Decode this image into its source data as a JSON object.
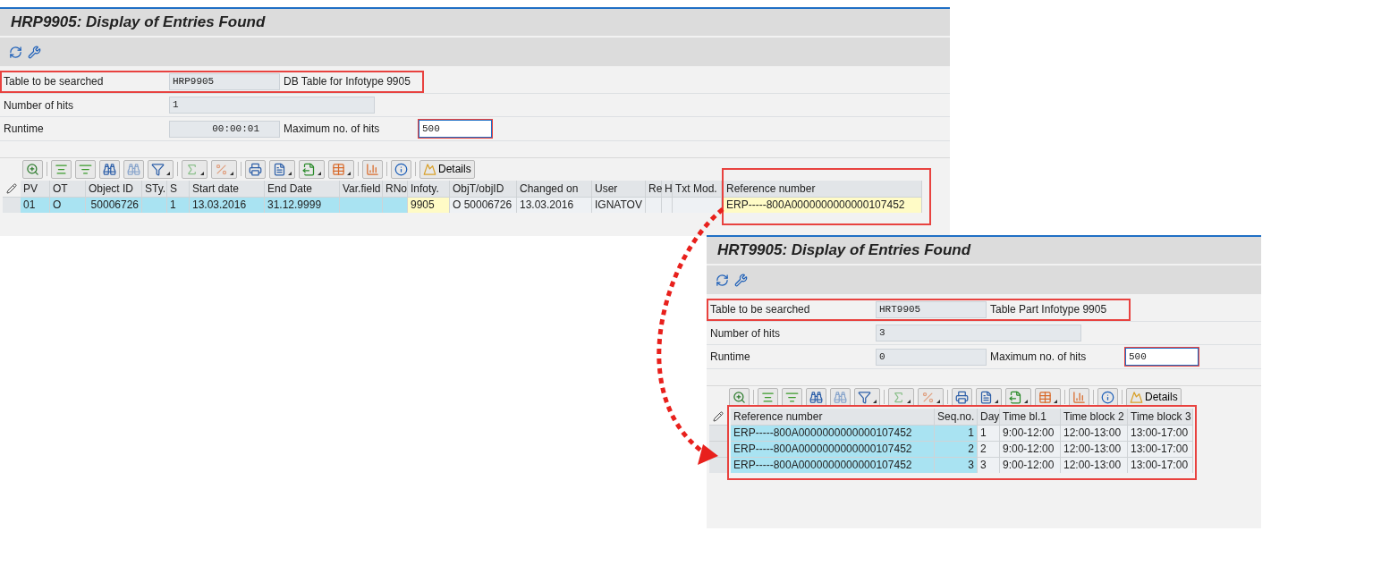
{
  "screens": [
    {
      "title": "HRP9905: Display of Entries Found",
      "fields": [
        {
          "label": "Table to be searched",
          "value": "HRP9905",
          "kind": "short",
          "side_label": "DB Table for Infotype 9905",
          "highlighted": true
        },
        {
          "label": "Number of hits",
          "value": "1",
          "kind": "long",
          "highlighted": false
        },
        {
          "label": "Runtime",
          "value": "00:00:01",
          "kind": "short",
          "side_label": "Maximum no. of hits",
          "side_input": "500",
          "highlighted": false
        }
      ],
      "details_button": "Details",
      "table": {
        "highlighted": false,
        "columns": [
          {
            "label": "PV",
            "kind": "key",
            "highlighted": false,
            "cells": [
              "01"
            ]
          },
          {
            "label": "OT",
            "kind": "key",
            "highlighted": false,
            "cells": [
              "O"
            ]
          },
          {
            "label": "Object ID",
            "kind": "key_num",
            "highlighted": false,
            "cells": [
              "50006726"
            ]
          },
          {
            "label": "STy.",
            "kind": "key",
            "highlighted": false,
            "cells": [
              ""
            ]
          },
          {
            "label": "S",
            "kind": "key",
            "highlighted": false,
            "cells": [
              "1"
            ]
          },
          {
            "label": "Start date",
            "kind": "key",
            "highlighted": false,
            "cells": [
              "13.03.2016"
            ]
          },
          {
            "label": "End Date",
            "kind": "key",
            "highlighted": false,
            "cells": [
              "31.12.9999"
            ]
          },
          {
            "label": "Var.field",
            "kind": "key",
            "highlighted": false,
            "cells": [
              ""
            ]
          },
          {
            "label": "RNo",
            "kind": "key",
            "highlighted": false,
            "cells": [
              ""
            ]
          },
          {
            "label": "Infoty.",
            "kind": "note",
            "highlighted": false,
            "cells": [
              "9905"
            ]
          },
          {
            "label": "ObjT/objID",
            "kind": "text",
            "highlighted": false,
            "cells": [
              "O 50006726"
            ]
          },
          {
            "label": "Changed on",
            "kind": "text",
            "highlighted": false,
            "cells": [
              "13.03.2016"
            ]
          },
          {
            "label": "User",
            "kind": "text",
            "highlighted": false,
            "cells": [
              "IGNATOV"
            ]
          },
          {
            "label": "Re",
            "kind": "text",
            "highlighted": false,
            "cells": [
              ""
            ]
          },
          {
            "label": "H",
            "kind": "text",
            "highlighted": false,
            "cells": [
              ""
            ]
          },
          {
            "label": "Txt Mod.",
            "kind": "text",
            "highlighted": false,
            "cells": [
              ""
            ]
          },
          {
            "label": "Reference number",
            "kind": "note",
            "highlighted": true,
            "cells": [
              "ERP-----800A0000000000000107452"
            ]
          }
        ]
      }
    },
    {
      "title": "HRT9905: Display of Entries Found",
      "fields": [
        {
          "label": "Table to be searched",
          "value": "HRT9905",
          "kind": "short",
          "side_label": "Table Part Infotype 9905",
          "highlighted": true
        },
        {
          "label": "Number of hits",
          "value": "3",
          "kind": "long",
          "highlighted": false
        },
        {
          "label": "Runtime",
          "value": "0",
          "kind": "short",
          "side_label": "Maximum no. of hits",
          "side_input": "500",
          "highlighted": false
        }
      ],
      "details_button": "Details",
      "table": {
        "highlighted": true,
        "columns": [
          {
            "label": "Reference number",
            "kind": "key",
            "highlighted": false,
            "cells": [
              "ERP-----800A0000000000000107452",
              "ERP-----800A0000000000000107452",
              "ERP-----800A0000000000000107452"
            ]
          },
          {
            "label": "Seq.no.",
            "kind": "key_num",
            "highlighted": false,
            "cells": [
              "1",
              "2",
              "3"
            ]
          },
          {
            "label": "Day",
            "kind": "text",
            "highlighted": false,
            "cells": [
              "1",
              "2",
              "3"
            ]
          },
          {
            "label": "Time bl.1",
            "kind": "text",
            "highlighted": false,
            "cells": [
              "9:00-12:00",
              "9:00-12:00",
              "9:00-12:00"
            ]
          },
          {
            "label": "Time block 2",
            "kind": "text",
            "highlighted": false,
            "cells": [
              "12:00-13:00",
              "12:00-13:00",
              "12:00-13:00"
            ]
          },
          {
            "label": "Time block 3",
            "kind": "text",
            "highlighted": false,
            "cells": [
              "13:00-17:00",
              "13:00-17:00",
              "13:00-17:00"
            ]
          }
        ]
      }
    }
  ]
}
